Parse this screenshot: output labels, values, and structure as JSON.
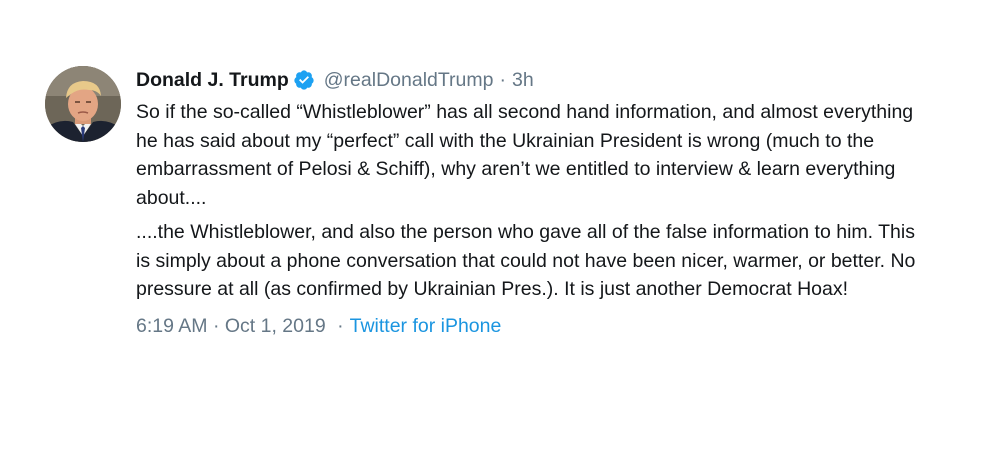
{
  "tweet": {
    "author_name": "Donald J. Trump",
    "handle": "@realDonaldTrump",
    "separator": "·",
    "relative_time": "3h",
    "paragraphs": [
      "So if the so-called “Whistleblower” has all second hand information, and almost everything he has said about my “perfect” call with the Ukrainian President is wrong (much to the embarrassment of Pelosi & Schiff), why aren’t we entitled to interview & learn everything about....",
      "....the Whistleblower, and also the person who gave all of the false information to him. This is simply about a phone conversation that could not have been nicer, warmer, or better. No pressure at all (as confirmed by Ukrainian Pres.). It is just another Democrat Hoax!"
    ],
    "timestamp": "6:19 AM · Oct 1, 2019",
    "meta_separator": "·",
    "source": "Twitter for iPhone"
  },
  "colors": {
    "text": "#14171a",
    "secondary": "#657786",
    "link": "#1b95e0",
    "verified_badge": "#1da1f2"
  },
  "icons": {
    "verified": "verified-badge-icon",
    "avatar": "profile-photo"
  }
}
